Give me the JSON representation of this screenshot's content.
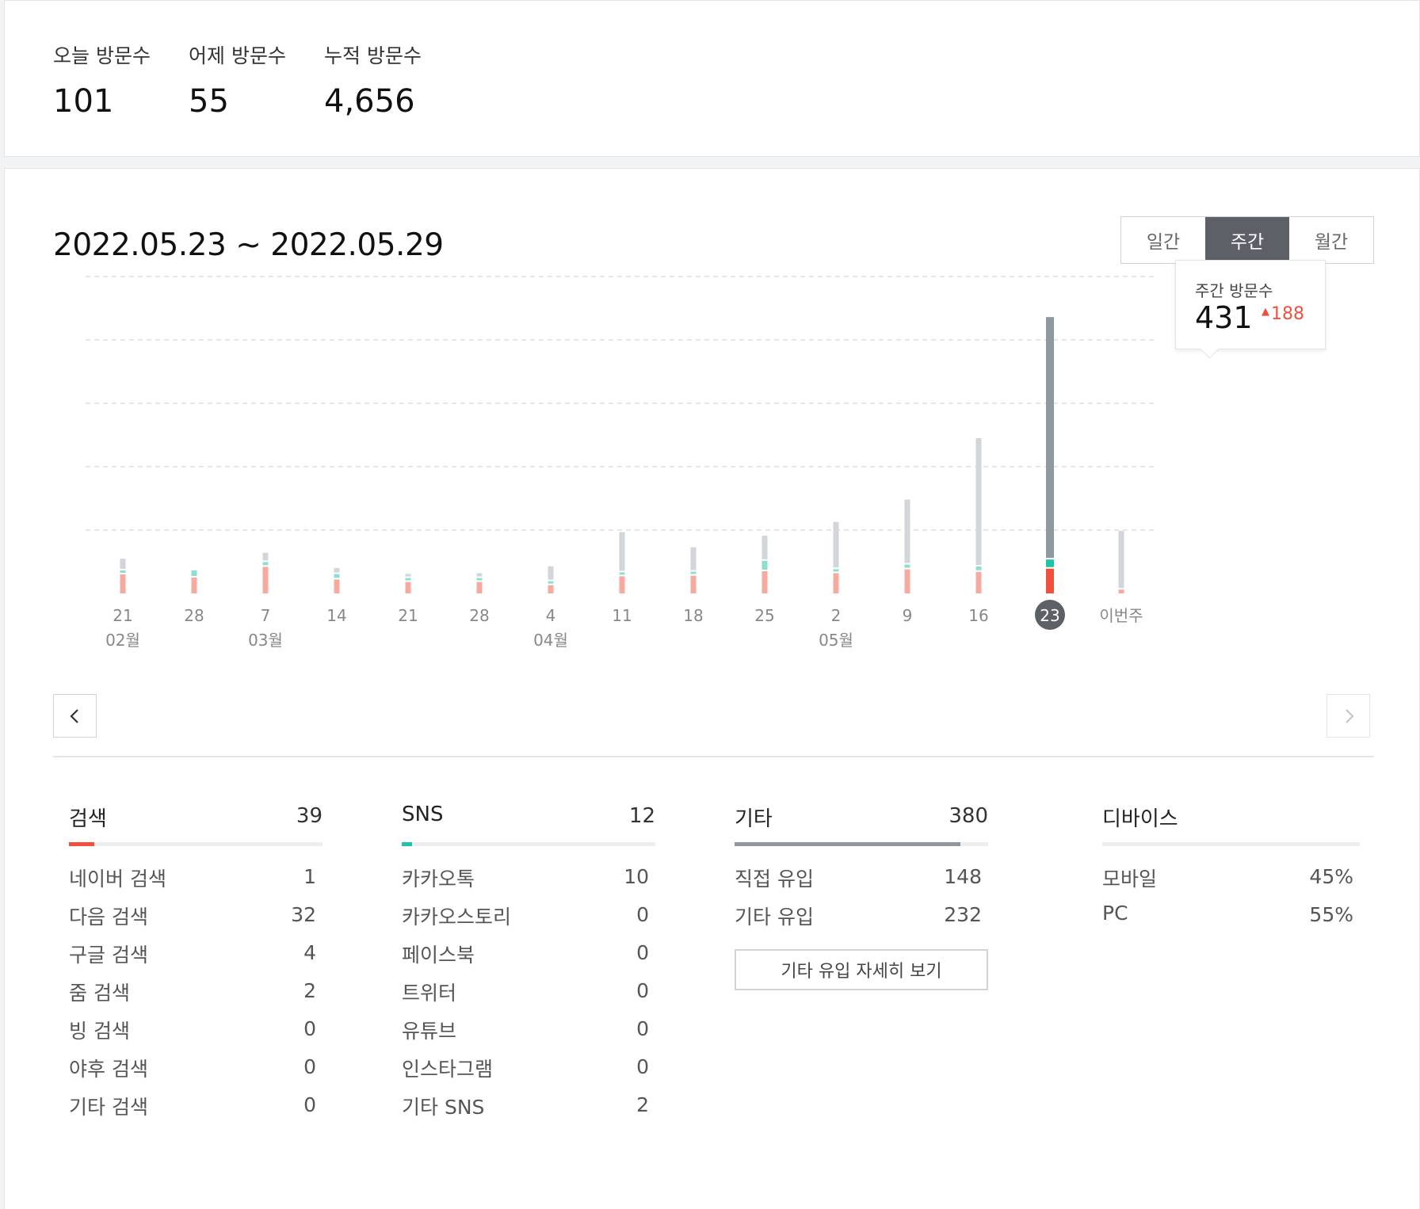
{
  "summary": {
    "today_label": "오늘 방문수",
    "today_value": "101",
    "yesterday_label": "어제 방문수",
    "yesterday_value": "55",
    "total_label": "누적 방문수",
    "total_value": "4,656"
  },
  "period": {
    "title": "2022.05.23 ~ 2022.05.29",
    "tabs": [
      "일간",
      "주간",
      "월간"
    ],
    "active_tab": "주간"
  },
  "tooltip": {
    "label": "주간 방문수",
    "value": "431",
    "change": "188",
    "change_direction": "up"
  },
  "colors": {
    "search": "#f2503e",
    "sns": "#23c1a8",
    "other": "#8f98a0",
    "search_light": "#f7aaa0",
    "sns_light": "#8be0d2",
    "other_light": "#d2d5d9",
    "active_week": "#5d6066"
  },
  "chart_data": {
    "type": "bar",
    "stacked": true,
    "categories": [
      "21",
      "28",
      "7",
      "14",
      "21",
      "28",
      "4",
      "11",
      "18",
      "25",
      "2",
      "9",
      "16",
      "23",
      "이번주"
    ],
    "month_labels": [
      {
        "index": 0,
        "label": "02월"
      },
      {
        "index": 2,
        "label": "03월"
      },
      {
        "index": 6,
        "label": "04월"
      },
      {
        "index": 10,
        "label": "05월"
      }
    ],
    "series": [
      {
        "key": "search",
        "values": [
          30,
          25,
          42,
          22,
          18,
          18,
          13,
          27,
          28,
          35,
          32,
          38,
          34,
          39,
          6
        ]
      },
      {
        "key": "sns",
        "values": [
          2,
          9,
          5,
          6,
          2,
          2,
          2,
          1,
          1,
          14,
          2,
          5,
          6,
          12,
          0
        ]
      },
      {
        "key": "other",
        "values": [
          16,
          0,
          12,
          7,
          4,
          5,
          21,
          61,
          36,
          37,
          72,
          100,
          200,
          380,
          90
        ]
      }
    ],
    "active_index": 13,
    "ylim": [
      0,
      500
    ],
    "grid_lines": 5
  },
  "sources": {
    "search": {
      "title": "검색",
      "total": "39",
      "fraction": 0.1,
      "items": [
        {
          "label": "네이버 검색",
          "value": "1"
        },
        {
          "label": "다음 검색",
          "value": "32"
        },
        {
          "label": "구글 검색",
          "value": "4"
        },
        {
          "label": "줌 검색",
          "value": "2"
        },
        {
          "label": "빙 검색",
          "value": "0"
        },
        {
          "label": "야후 검색",
          "value": "0"
        },
        {
          "label": "기타 검색",
          "value": "0"
        }
      ]
    },
    "sns": {
      "title": "SNS",
      "total": "12",
      "fraction": 0.04,
      "items": [
        {
          "label": "카카오톡",
          "value": "10"
        },
        {
          "label": "카카오스토리",
          "value": "0"
        },
        {
          "label": "페이스북",
          "value": "0"
        },
        {
          "label": "트위터",
          "value": "0"
        },
        {
          "label": "유튜브",
          "value": "0"
        },
        {
          "label": "인스타그램",
          "value": "0"
        },
        {
          "label": "기타 SNS",
          "value": "2"
        }
      ]
    },
    "other": {
      "title": "기타",
      "total": "380",
      "fraction": 0.89,
      "items": [
        {
          "label": "직접 유입",
          "value": "148"
        },
        {
          "label": "기타 유입",
          "value": "232"
        }
      ],
      "detail_button": "기타 유입 자세히 보기"
    },
    "device": {
      "title": "디바이스",
      "items": [
        {
          "label": "모바일",
          "value": "45%"
        },
        {
          "label": "PC",
          "value": "55%"
        }
      ]
    }
  }
}
